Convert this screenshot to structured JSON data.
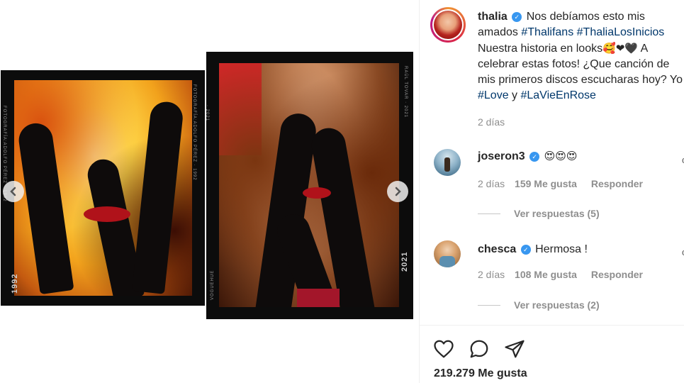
{
  "media": {
    "left_photo": {
      "year": "1992",
      "side_credit": "FOTOGRAFÍA:ADOLFO PÉREZ · 1992",
      "top_credit": "FOTOGRAFÍA:ADOLFO PÉREZ · 1992"
    },
    "right_photo": {
      "year": "2021",
      "side_credit": "RAÚL TOVAR · 2021",
      "brand": "VOGUEHUE",
      "top_year": "· 2021"
    },
    "prev_icon": "chevron-left-icon",
    "next_icon": "chevron-right-icon"
  },
  "post": {
    "username": "thalia",
    "caption_parts": {
      "p1": "Nos debíamos esto mis amados ",
      "tag1": "#Thalifans",
      "tag2": "#ThaliaLosInicios",
      "p2": "Nuestra historia en looks",
      "emojis": "🥰❤🖤",
      "p3": " A celebrar estas fotos! ¿Que canción de mis primeros discos escucharas hoy? Yo ",
      "tag3": "#Love",
      "p4": " y ",
      "tag4": "#LaVieEnRose"
    },
    "time": "2 días"
  },
  "comments": [
    {
      "username": "joseron3",
      "text": "😍😍😍",
      "time": "2 días",
      "likes": "159 Me gusta",
      "reply": "Responder",
      "view_replies": "Ver respuestas (5)"
    },
    {
      "username": "chesca",
      "text": "Hermosa !",
      "time": "2 días",
      "likes": "108 Me gusta",
      "reply": "Responder",
      "view_replies": "Ver respuestas (2)"
    }
  ],
  "actions": {
    "like_icon": "heart-icon",
    "comment_icon": "comment-icon",
    "share_icon": "send-icon",
    "likes_count": "219.279 Me gusta"
  },
  "colors": {
    "verified": "#3897f0",
    "hashtag": "#00376b",
    "muted": "#8e8e8e"
  }
}
